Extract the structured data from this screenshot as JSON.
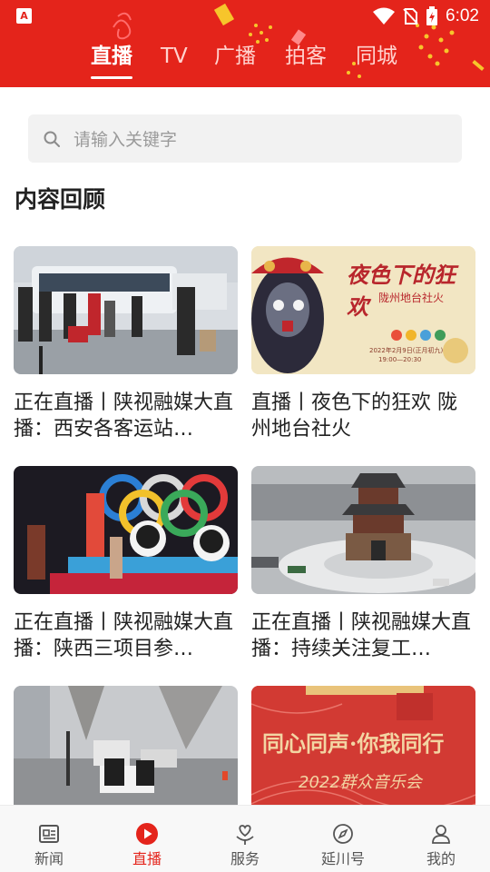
{
  "status": {
    "app_badge": "A",
    "time": "6:02"
  },
  "tabs": [
    {
      "label": "直播",
      "active": true
    },
    {
      "label": "TV",
      "active": false
    },
    {
      "label": "广播",
      "active": false
    },
    {
      "label": "拍客",
      "active": false
    },
    {
      "label": "同城",
      "active": false
    }
  ],
  "search": {
    "placeholder": "请输入关键字"
  },
  "section": {
    "title": "内容回顾"
  },
  "cards": [
    {
      "title": "正在直播丨陕视融媒大直播：西安各客运站…",
      "image": "bus-station-photo"
    },
    {
      "title": "直播丨夜色下的狂欢 陇州地台社火",
      "image": "opera-mask-poster",
      "poster_title": "夜色下的狂欢",
      "poster_sub": "陇州地台社火",
      "poster_date": "2022年2月9日(正月初九)",
      "poster_time": "19:00—20:30"
    },
    {
      "title": "正在直播丨陕视融媒大直播：陕西三项目参…",
      "image": "lantern-olympic-rings-photo"
    },
    {
      "title": "正在直播丨陕视融媒大直播：持续关注复工…",
      "image": "bell-tower-snow-photo"
    },
    {
      "title": "",
      "image": "snow-street-police-photo"
    },
    {
      "title": "",
      "image": "concert-poster",
      "poster_title": "同心同声·你我同行",
      "poster_sub": "2022群众音乐会"
    }
  ],
  "bottom_nav": [
    {
      "label": "新闻",
      "icon": "newspaper-icon",
      "active": false
    },
    {
      "label": "直播",
      "icon": "play-circle-icon",
      "active": true
    },
    {
      "label": "服务",
      "icon": "heart-hand-icon",
      "active": false
    },
    {
      "label": "延川号",
      "icon": "compass-icon",
      "active": false
    },
    {
      "label": "我的",
      "icon": "user-icon",
      "active": false
    }
  ],
  "colors": {
    "brand_red": "#e4241b",
    "nav_active": "#e4241b",
    "text": "#222222"
  }
}
